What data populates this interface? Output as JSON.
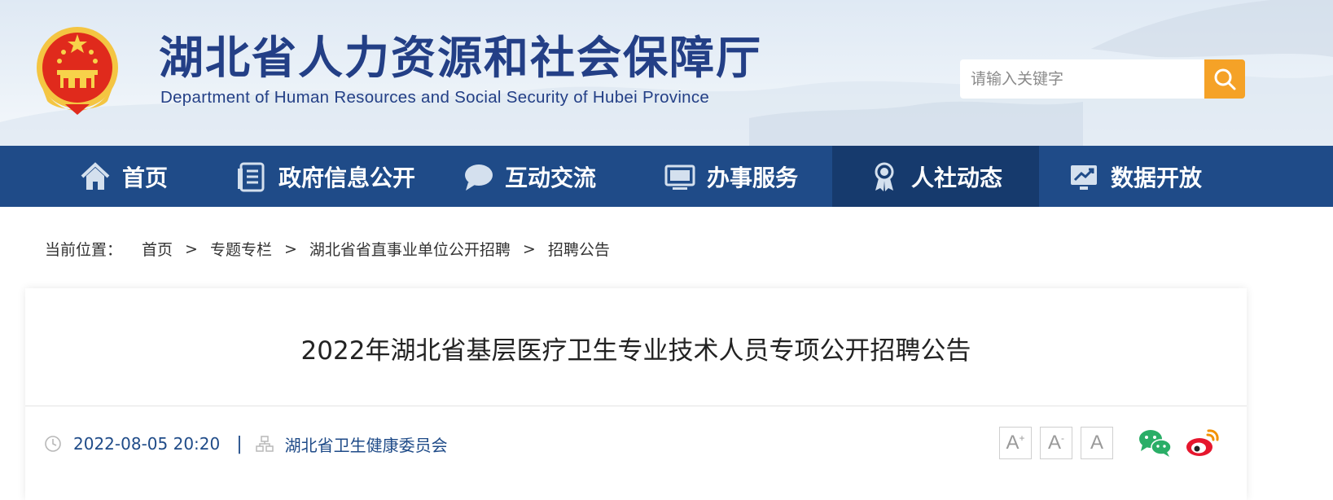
{
  "header": {
    "title": "湖北省人力资源和社会保障厅",
    "subtitle": "Department of Human Resources and Social Security of Hubei Province",
    "search_placeholder": "请输入关键字"
  },
  "nav": {
    "items": [
      {
        "label": "首页",
        "icon": "home-icon"
      },
      {
        "label": "政府信息公开",
        "icon": "document-icon"
      },
      {
        "label": "互动交流",
        "icon": "chat-bubble-icon"
      },
      {
        "label": "办事服务",
        "icon": "monitor-icon"
      },
      {
        "label": "人社动态",
        "icon": "award-ribbon-icon",
        "active": true
      },
      {
        "label": "数据开放",
        "icon": "chart-up-icon"
      }
    ]
  },
  "breadcrumb": {
    "label": "当前位置：",
    "items": [
      "首页",
      "专题专栏",
      "湖北省省直事业单位公开招聘",
      "招聘公告"
    ],
    "separator": ">"
  },
  "article": {
    "title": "2022年湖北省基层医疗卫生专业技术人员专项公开招聘公告",
    "date": "2022-08-05 20:20",
    "meta_separator": "|",
    "source": "湖北省卫生健康委员会"
  },
  "tools": {
    "font_larger": "A",
    "font_larger_mark": "+",
    "font_smaller": "A",
    "font_smaller_mark": "-",
    "font_reset": "A"
  },
  "colors": {
    "nav_bg": "#1f4b88",
    "nav_active_bg": "#163a6d",
    "title_blue": "#233f86",
    "search_button": "#f5a227",
    "wechat_green": "#2aae67",
    "weibo_orange": "#f29100"
  }
}
